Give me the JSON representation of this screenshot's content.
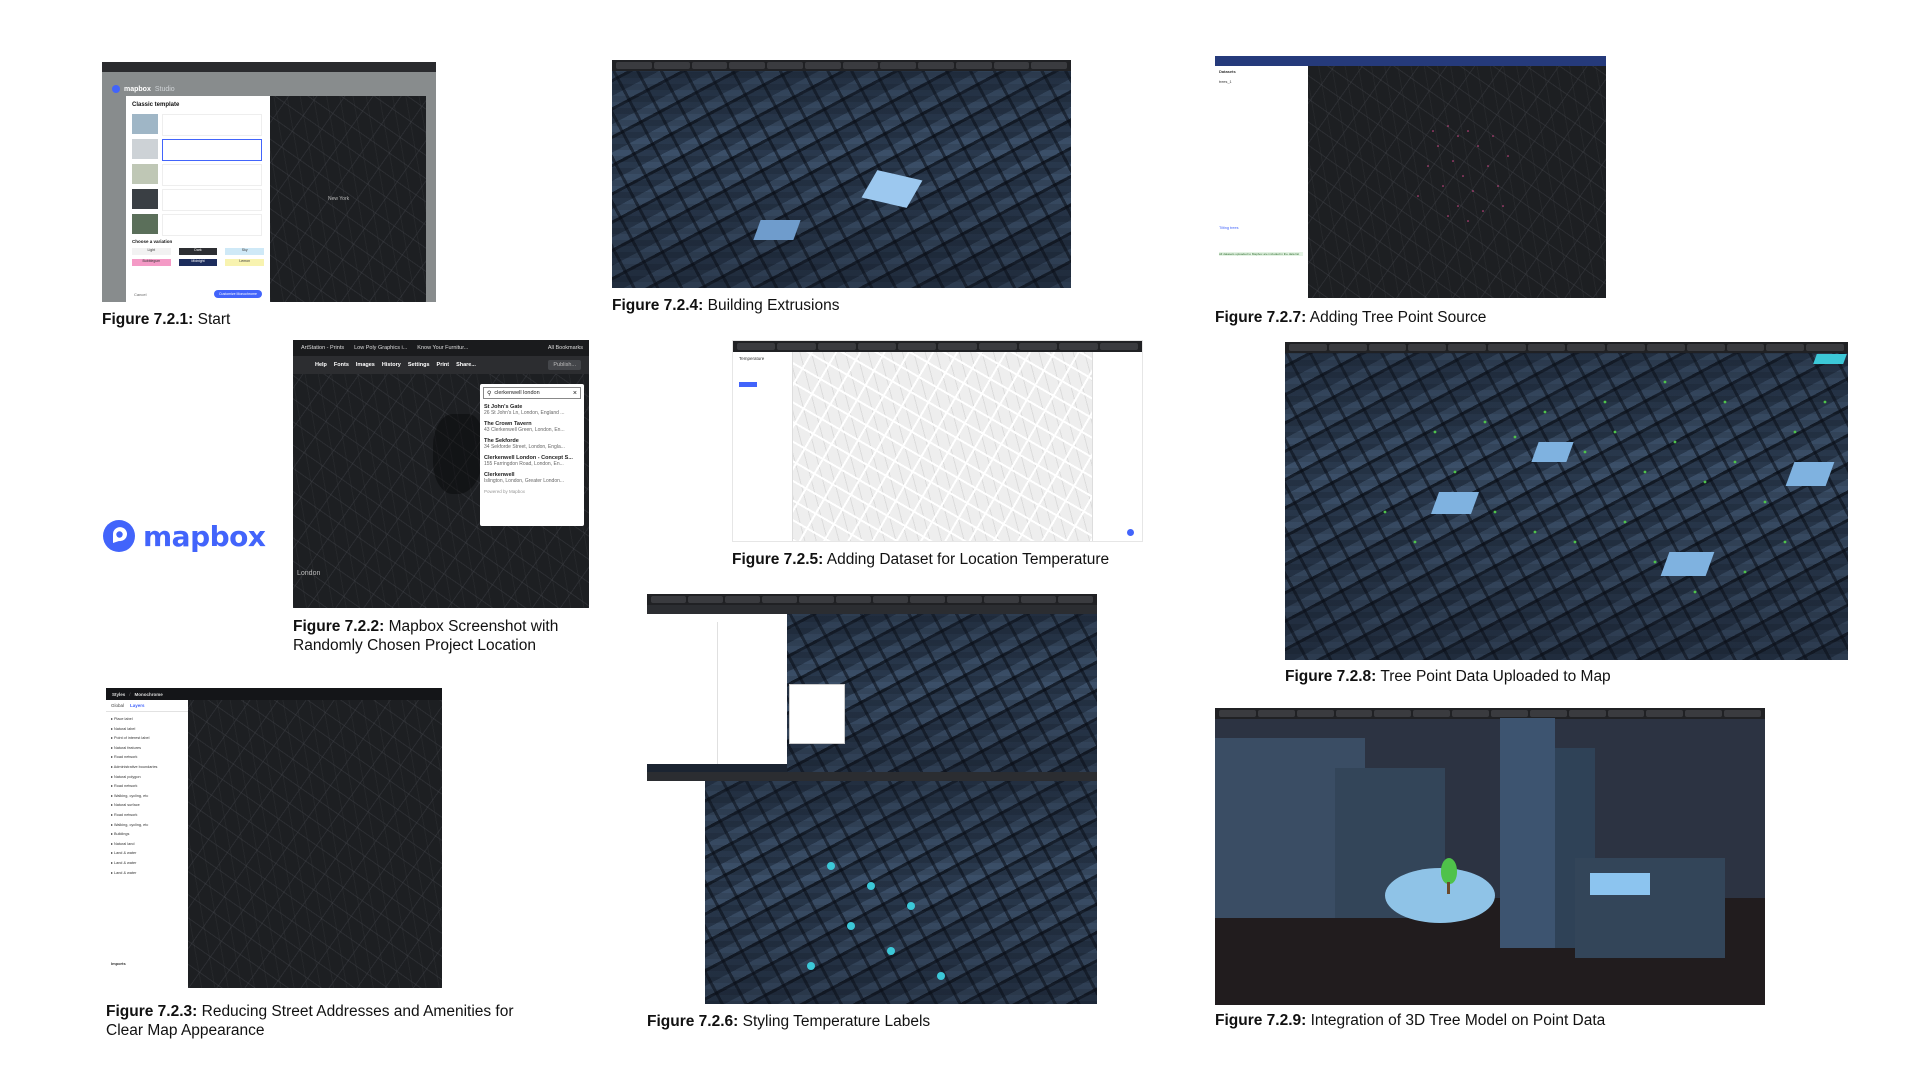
{
  "logo": {
    "wordmark": "mapbox",
    "brand_color": "#4264fb"
  },
  "figures": [
    {
      "num": "Figure 7.2.1:",
      "text": "Start"
    },
    {
      "num": "Figure 7.2.2:",
      "text": "Mapbox Screenshot with Randomly Chosen Project Location"
    },
    {
      "num": "Figure 7.2.3:",
      "text": "Reducing Street Addresses and Amenities for Clear Map Appearance"
    },
    {
      "num": "Figure 7.2.4:",
      "text": "Building Extrusions"
    },
    {
      "num": "Figure 7.2.5:",
      "text": "Adding Dataset for Location Temperature"
    },
    {
      "num": "Figure 7.2.6:",
      "text": "Styling Temperature Labels"
    },
    {
      "num": "Figure 7.2.7:",
      "text": "Adding Tree Point Source"
    },
    {
      "num": "Figure 7.2.8:",
      "text": "Tree Point Data Uploaded to Map"
    },
    {
      "num": "Figure 7.2.9:",
      "text": "Integration of 3D Tree Model on Point Data"
    }
  ],
  "fig1": {
    "app": "mapbox",
    "product": "Studio",
    "dialog_title": "Classic template",
    "section_variation": "Choose a variation",
    "variations": [
      "Light",
      "Dark",
      "Sky",
      "Bubblegum",
      "Midnight",
      "Lemon"
    ],
    "cancel": "Cancel",
    "customize": "Customize Monochrome",
    "city_label": "New York"
  },
  "fig2": {
    "tabs": [
      "ArtStation - Prints",
      "Low Poly Graphics i...",
      "Know Your Furnitur..."
    ],
    "bookmarks": "All Bookmarks",
    "toolbar": [
      "Help",
      "Fonts",
      "Images",
      "History",
      "Settings",
      "Print",
      "Share..."
    ],
    "publish": "Publish...",
    "search_value": "clerkenwell london",
    "results": [
      {
        "title": "St John's Gate",
        "sub": "26 St John's Ln, London, England ..."
      },
      {
        "title": "The Crown Tavern",
        "sub": "43 Clerkenwell Green, London, En..."
      },
      {
        "title": "The Sekforde",
        "sub": "34 Sekforde Street, London, Engla..."
      },
      {
        "title": "Clerkenwell London - Concept S...",
        "sub": "155 Farringdon Road, London, En..."
      },
      {
        "title": "Clerkenwell",
        "sub": "Islington, London, Greater London..."
      }
    ],
    "powered": "Powered by Mapbox",
    "city_label": "London"
  },
  "fig3": {
    "crumbs": [
      "Styles",
      "Monochrome"
    ],
    "tabs": [
      "Global",
      "Layers"
    ],
    "layers": [
      "Place label",
      "Natural label",
      "Point of interest label",
      "Natural features",
      "Road network",
      "Administrative boundaries",
      "Natural polygon",
      "Road network",
      "Walking, cycling, etc",
      "Natural surface",
      "Road network",
      "Walking, cycling, etc",
      "Buildings",
      "Natural land",
      "Land & water",
      "Land & water",
      "Land & water"
    ],
    "footer": "Imports"
  },
  "fig5": {
    "panel_title": "Temperature"
  },
  "fig7": {
    "panel_title": "Datasets",
    "layer": "trees_1",
    "layer2": "Tilting trees",
    "note": "All datasets uploaded to Mapbox are included in the data list"
  },
  "colors": {
    "dark_bg": "#1b2431",
    "building": "#3c5676",
    "building_light": "#7fb2e0",
    "tree_green": "#4fc24a",
    "temp_cyan": "#3cc8d8",
    "pink": "#d8488c"
  }
}
